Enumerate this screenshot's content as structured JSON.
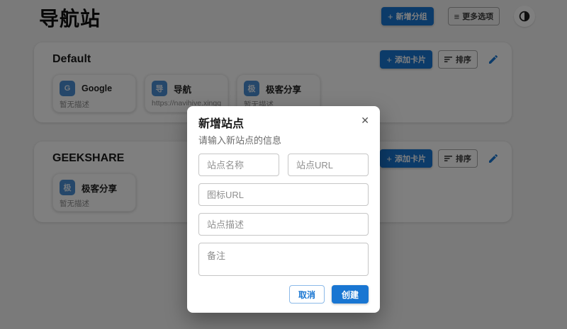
{
  "header": {
    "title": "导航站",
    "add_group_label": "新增分组",
    "more_options_label": "更多选项"
  },
  "icons": {
    "plus": "+",
    "menu": "≡",
    "close": "✕",
    "sort": "sort-lines-icon",
    "edit": "pencil-icon",
    "theme": "dark-mode-icon"
  },
  "groups": [
    {
      "name": "Default",
      "add_card_label": "添加卡片",
      "sort_label": "排序",
      "sites": [
        {
          "avatar": "G",
          "title": "Google",
          "subtitle": "暂无描述"
        },
        {
          "avatar": "导",
          "title": "导航",
          "subtitle": "https://navihive.xingqiong.i"
        },
        {
          "avatar": "极",
          "title": "极客分享",
          "subtitle": "暂无描述"
        }
      ]
    },
    {
      "name": "GEEKSHARE",
      "add_card_label": "添加卡片",
      "sort_label": "排序",
      "sites": [
        {
          "avatar": "极",
          "title": "极客分享",
          "subtitle": "暂无描述"
        }
      ]
    }
  ],
  "modal": {
    "title": "新增站点",
    "subtitle": "请输入新站点的信息",
    "fields": {
      "site_name": "站点名称",
      "site_url": "站点URL",
      "icon_url": "图标URL",
      "site_description": "站点描述",
      "remark": "备注"
    },
    "cancel_label": "取消",
    "create_label": "创建"
  },
  "colors": {
    "primary": "#1976d2",
    "avatar_bg": "#4a8fd4",
    "page_bg": "#f5f5f5",
    "overlay": "rgba(0,0,0,0.5)"
  }
}
